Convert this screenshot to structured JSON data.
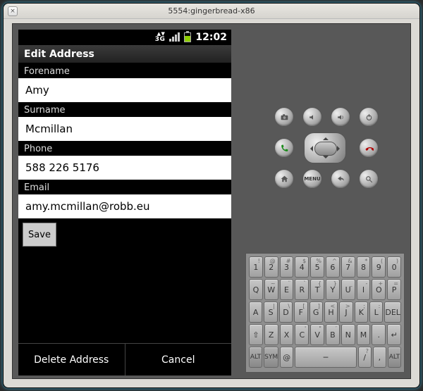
{
  "host": {
    "title": "5554:gingerbread-x86",
    "close_glyph": "×"
  },
  "statusbar": {
    "net": "3G",
    "clock": "12:02"
  },
  "app": {
    "title": "Edit Address"
  },
  "form": {
    "forename_label": "Forename",
    "forename_value": "Amy",
    "surname_label": "Surname",
    "surname_value": "Mcmillan",
    "phone_label": "Phone",
    "phone_value": "588 226 5176",
    "email_label": "Email",
    "email_value": "amy.mcmillan@robb.eu",
    "save_label": "Save"
  },
  "bottom": {
    "delete_label": "Delete Address",
    "cancel_label": "Cancel"
  },
  "emu_buttons": {
    "menu_label": "MENU"
  },
  "keyboard": {
    "row1": [
      {
        "main": "1",
        "sub": "!"
      },
      {
        "main": "2",
        "sub": "@"
      },
      {
        "main": "3",
        "sub": "#"
      },
      {
        "main": "4",
        "sub": "$"
      },
      {
        "main": "5",
        "sub": "%"
      },
      {
        "main": "6",
        "sub": "^"
      },
      {
        "main": "7",
        "sub": "&"
      },
      {
        "main": "8",
        "sub": "*"
      },
      {
        "main": "9",
        "sub": "("
      },
      {
        "main": "0",
        "sub": ")"
      }
    ],
    "row2": [
      {
        "main": "Q"
      },
      {
        "main": "W",
        "sub": "~"
      },
      {
        "main": "E",
        "sub": "¨"
      },
      {
        "main": "R",
        "sub": "`"
      },
      {
        "main": "T",
        "sub": "{"
      },
      {
        "main": "Y",
        "sub": "}"
      },
      {
        "main": "U",
        "sub": "_"
      },
      {
        "main": "I",
        "sub": "-"
      },
      {
        "main": "O",
        "sub": "+"
      },
      {
        "main": "P",
        "sub": "="
      }
    ],
    "row3": [
      {
        "main": "A"
      },
      {
        "main": "S",
        "sub": "|"
      },
      {
        "main": "D",
        "sub": "\\"
      },
      {
        "main": "F",
        "sub": "["
      },
      {
        "main": "G",
        "sub": "]"
      },
      {
        "main": "H",
        "sub": "<"
      },
      {
        "main": "J",
        "sub": ">"
      },
      {
        "main": "K",
        "sub": ";"
      },
      {
        "main": "L",
        "sub": ":"
      },
      {
        "main": "DEL",
        "sub": ""
      }
    ],
    "row4": [
      {
        "main": "⇧"
      },
      {
        "main": "Z"
      },
      {
        "main": "X"
      },
      {
        "main": "C",
        "sub": "'"
      },
      {
        "main": "V",
        "sub": "\""
      },
      {
        "main": "B",
        "sub": "′"
      },
      {
        "main": "N"
      },
      {
        "main": "M"
      },
      {
        "main": ".",
        "sub": ""
      },
      {
        "main": "↵"
      }
    ],
    "row5": {
      "alt": "ALT",
      "sym": "SYM",
      "at": "@",
      "slash": "/",
      "comma": ",",
      "q": "?",
      "alt2": "ALT"
    }
  }
}
